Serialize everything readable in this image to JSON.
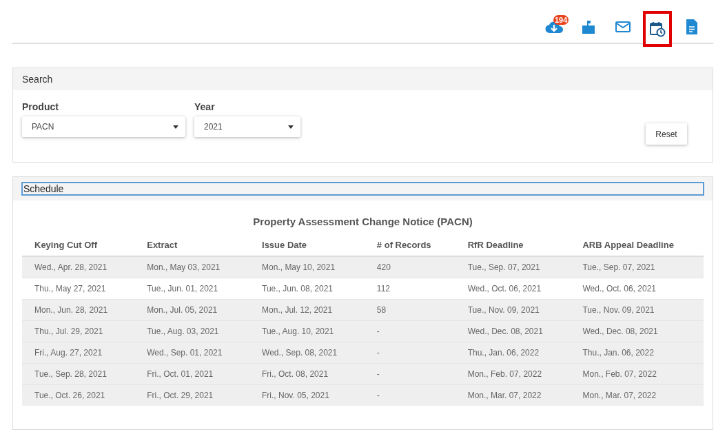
{
  "toolbar": [
    {
      "kind": "download",
      "badge": "194",
      "selected": false
    },
    {
      "kind": "mailbox",
      "selected": false
    },
    {
      "kind": "mail",
      "selected": false
    },
    {
      "kind": "calendar",
      "selected": true
    },
    {
      "kind": "document",
      "selected": false
    }
  ],
  "search": {
    "title": "Search",
    "fields": [
      {
        "label": "Product",
        "value": "PACN"
      },
      {
        "label": "Year",
        "value": "2021"
      }
    ],
    "reset": "Reset"
  },
  "schedule": {
    "title": "Schedule",
    "heading": "Property Assessment Change Notice (PACN)",
    "columns": [
      "Keying Cut Off",
      "Extract",
      "Issue Date",
      "# of Records",
      "RfR Deadline",
      "ARB Appeal Deadline"
    ],
    "rows": [
      {
        "shaded": true,
        "cells": [
          "Wed., Apr. 28, 2021",
          "Mon., May 03, 2021",
          "Mon., May 10, 2021",
          "420",
          "Tue., Sep. 07, 2021",
          "Tue., Sep. 07, 2021"
        ]
      },
      {
        "shaded": false,
        "cells": [
          "Thu., May 27, 2021",
          "Tue., Jun. 01, 2021",
          "Tue., Jun. 08, 2021",
          "112",
          "Wed., Oct. 06, 2021",
          "Wed., Oct. 06, 2021"
        ]
      },
      {
        "shaded": true,
        "cells": [
          "Mon., Jun. 28, 2021",
          "Mon., Jul. 05, 2021",
          "Mon., Jul. 12, 2021",
          "58",
          "Tue., Nov. 09, 2021",
          "Tue., Nov. 09, 2021"
        ]
      },
      {
        "shaded": true,
        "cells": [
          "Thu., Jul. 29, 2021",
          "Tue., Aug. 03, 2021",
          "Tue., Aug. 10, 2021",
          "-",
          "Wed., Dec. 08, 2021",
          "Wed., Dec. 08, 2021"
        ]
      },
      {
        "shaded": true,
        "cells": [
          "Fri., Aug. 27, 2021",
          "Wed., Sep. 01, 2021",
          "Wed., Sep. 08, 2021",
          "-",
          "Thu., Jan. 06, 2022",
          "Thu., Jan. 06, 2022"
        ]
      },
      {
        "shaded": true,
        "cells": [
          "Tue., Sep. 28, 2021",
          "Fri., Oct. 01, 2021",
          "Fri., Oct. 08, 2021",
          "-",
          "Mon., Feb. 07, 2022",
          "Mon., Feb. 07, 2022"
        ]
      },
      {
        "shaded": true,
        "cells": [
          "Tue., Oct. 26, 2021",
          "Fri., Oct. 29, 2021",
          "Fri., Nov. 05, 2021",
          "-",
          "Mon., Mar. 07, 2022",
          "Mon., Mar. 07, 2022"
        ]
      }
    ]
  }
}
